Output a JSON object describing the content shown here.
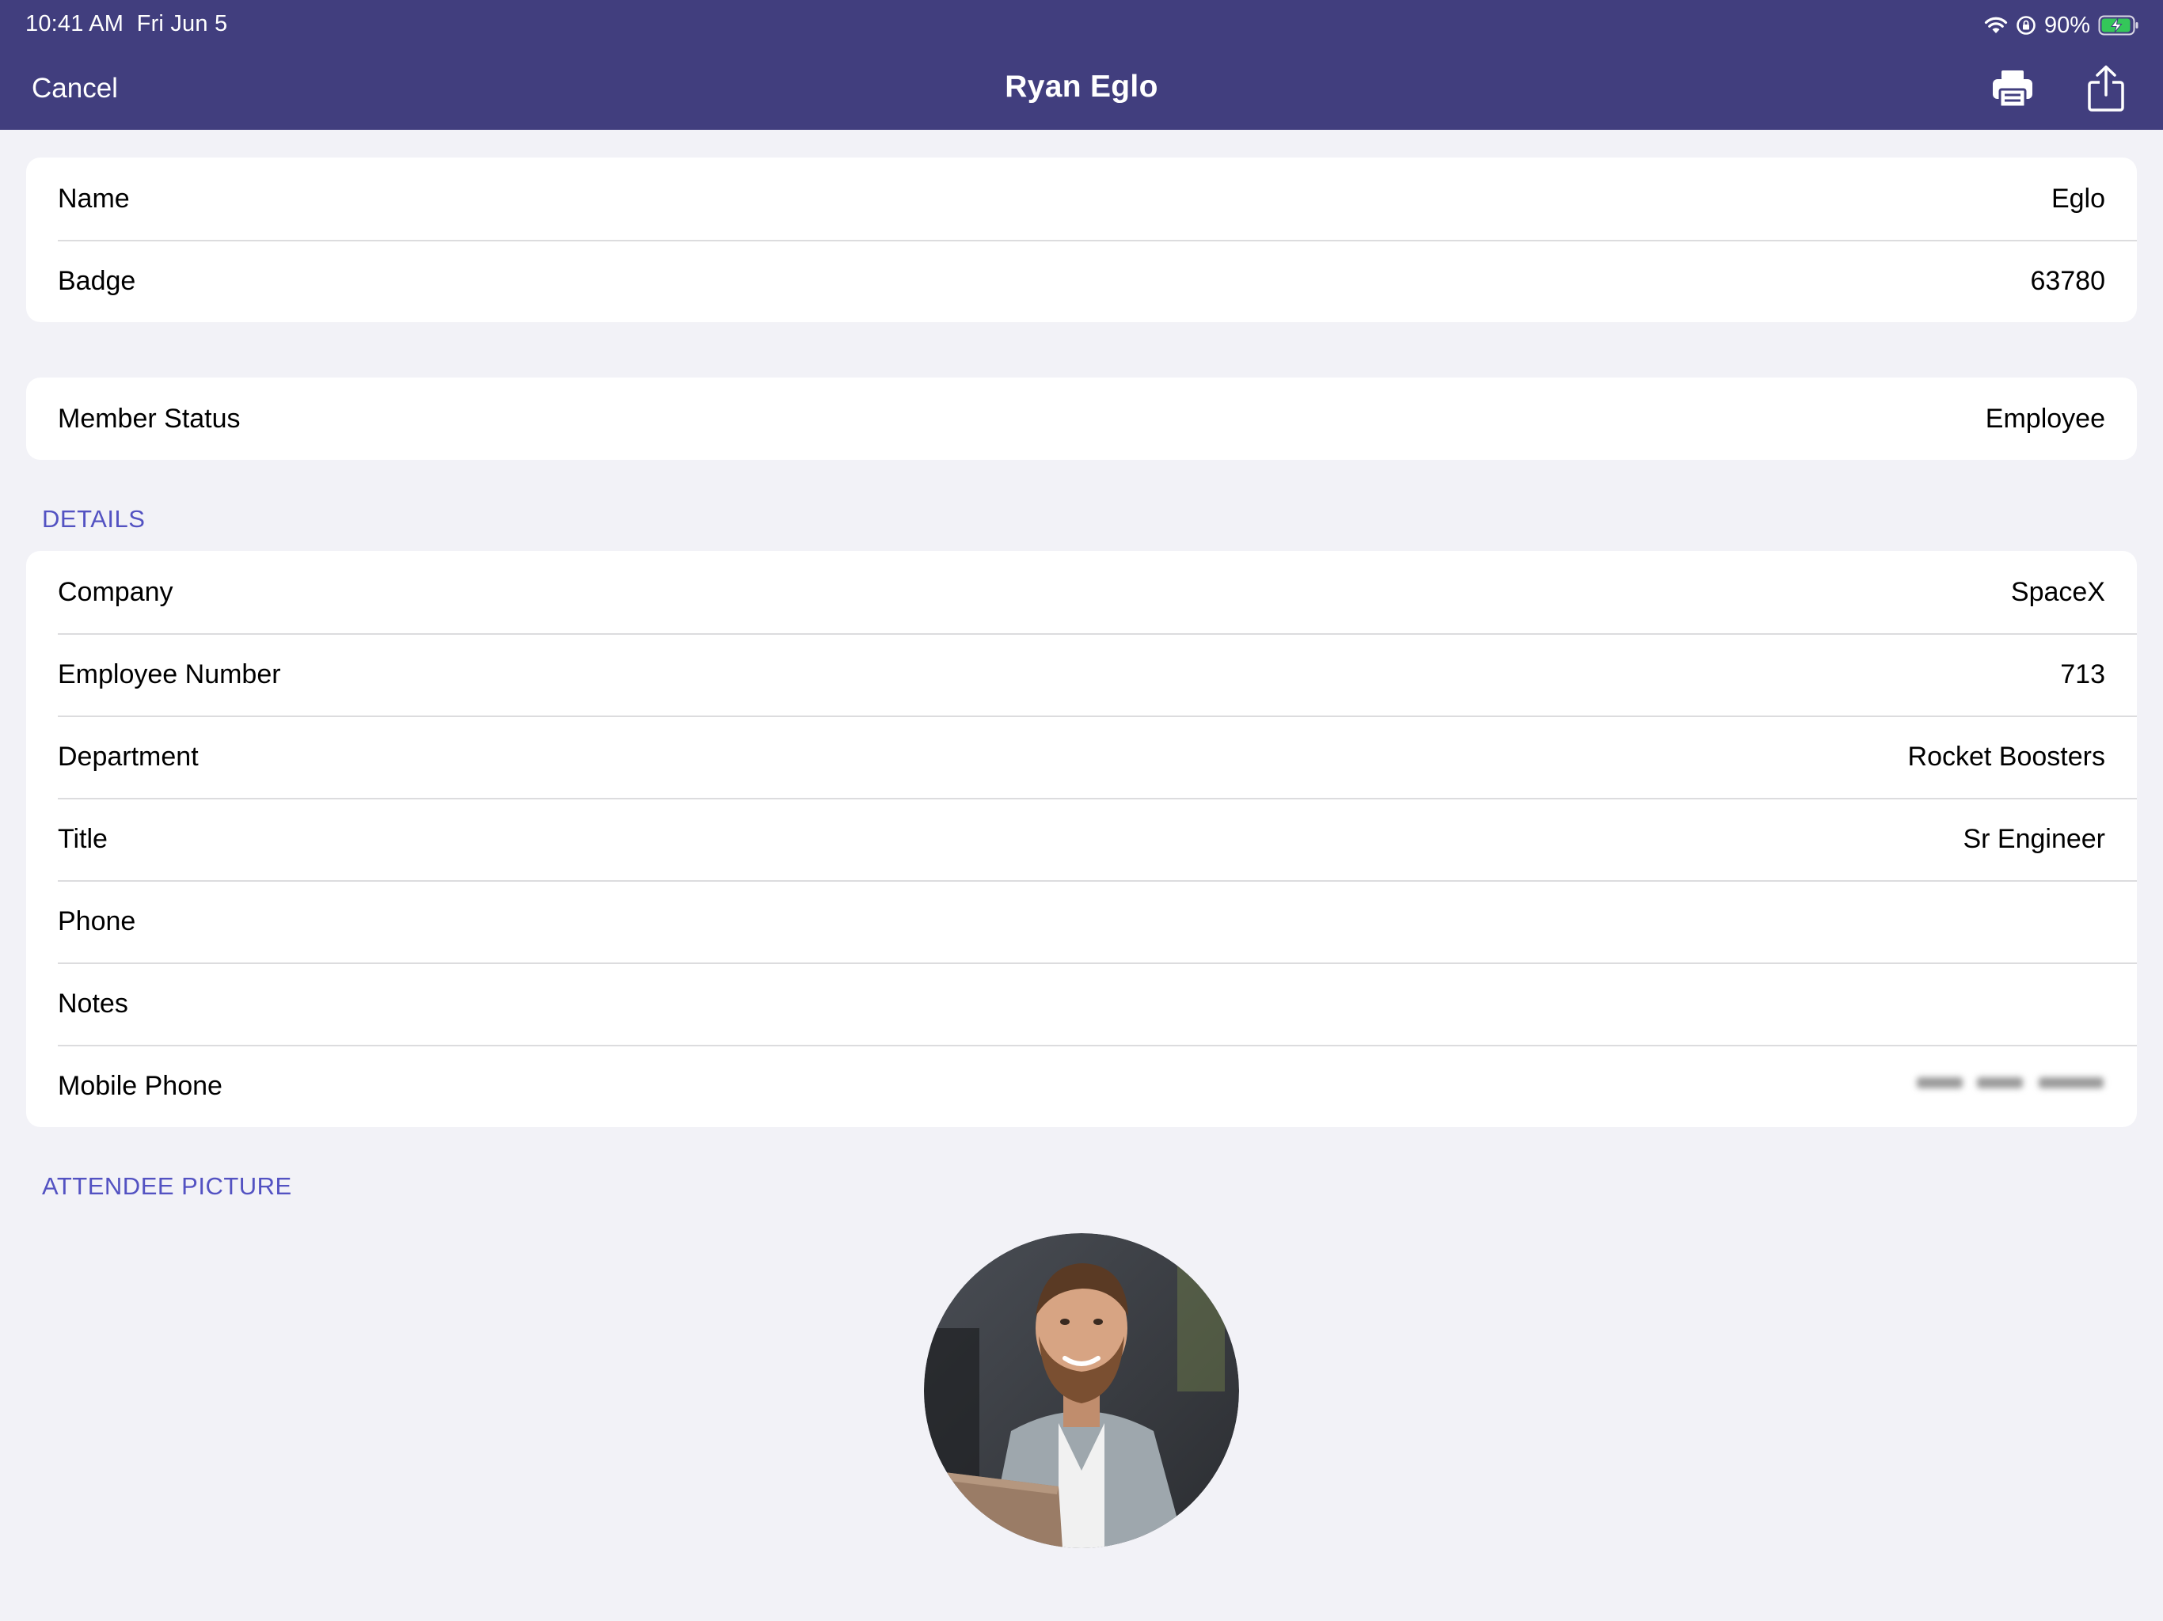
{
  "status_bar": {
    "time": "10:41 AM",
    "date": "Fri Jun 5",
    "battery": "90%",
    "icons": [
      "wifi-icon",
      "rotation-lock-icon",
      "battery-charging-icon"
    ]
  },
  "nav": {
    "cancel_label": "Cancel",
    "title": "Ryan  Eglo",
    "actions": [
      "printer-icon",
      "share-icon"
    ]
  },
  "colors": {
    "nav_background": "#413e7e",
    "page_background": "#f2f2f7",
    "section_header": "#5352c2",
    "battery_fill": "#34c759"
  },
  "identity": {
    "rows": [
      {
        "label": "Name",
        "value": "Eglo"
      },
      {
        "label": "Badge",
        "value": "63780"
      }
    ]
  },
  "membership": {
    "rows": [
      {
        "label": "Member Status",
        "value": "Employee"
      }
    ]
  },
  "details": {
    "header": "DETAILS",
    "rows": [
      {
        "label": "Company",
        "value": "SpaceX"
      },
      {
        "label": "Employee Number",
        "value": "713"
      },
      {
        "label": "Department",
        "value": "Rocket Boosters"
      },
      {
        "label": "Title",
        "value": "Sr Engineer"
      },
      {
        "label": "Phone",
        "value": ""
      },
      {
        "label": "Notes",
        "value": ""
      },
      {
        "label": "Mobile Phone",
        "value": ""
      }
    ]
  },
  "attendee_picture": {
    "header": "ATTENDEE PICTURE"
  }
}
